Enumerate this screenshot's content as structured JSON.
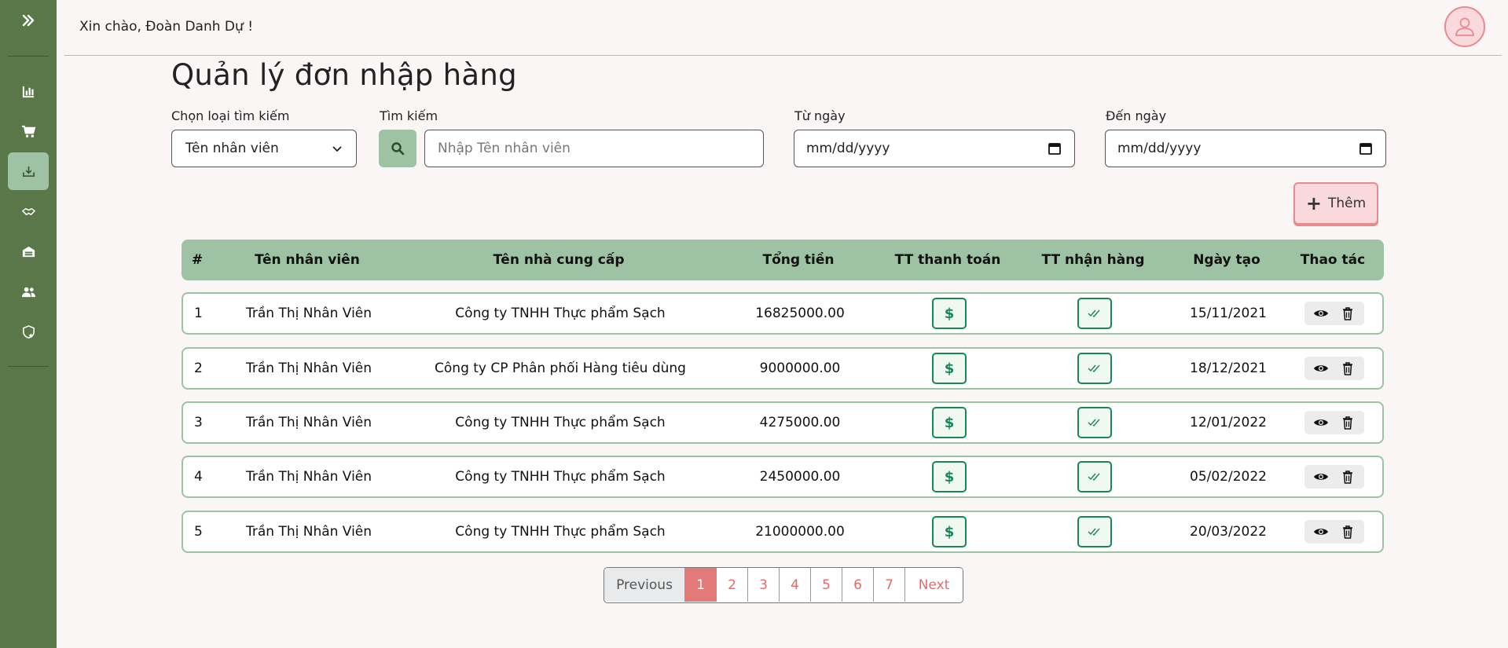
{
  "header": {
    "greeting": "Xin chào, Đoàn Danh Dự !"
  },
  "sidebar": {
    "items": [
      {
        "icon": "bar-chart-icon"
      },
      {
        "icon": "cart-icon"
      },
      {
        "icon": "import-icon",
        "active": true
      },
      {
        "icon": "handshake-icon"
      },
      {
        "icon": "warehouse-icon"
      },
      {
        "icon": "users-icon"
      },
      {
        "icon": "shield-star-icon"
      }
    ]
  },
  "page": {
    "title": "Quản lý đơn nhập hàng"
  },
  "filters": {
    "search_type_label": "Chọn loại tìm kiếm",
    "search_type_value": "Tên nhân viên",
    "search_label": "Tìm kiếm",
    "search_placeholder": "Nhập Tên nhân viên",
    "from_date_label": "Từ ngày",
    "from_date_value": "mm/dd/yyyy",
    "to_date_label": "Đến ngày",
    "to_date_value": "mm/dd/yyyy"
  },
  "add_button": "Thêm",
  "table": {
    "headers": [
      "#",
      "Tên nhân viên",
      "Tên nhà cung cấp",
      "Tổng tiền",
      "TT thanh toán",
      "TT nhận hàng",
      "Ngày tạo",
      "Thao tác"
    ],
    "rows": [
      {
        "id": "1",
        "employee": "Trần Thị Nhân Viên",
        "supplier": "Công ty TNHH Thực phẩm Sạch",
        "total": "16825000.00",
        "date": "15/11/2021"
      },
      {
        "id": "2",
        "employee": "Trần Thị Nhân Viên",
        "supplier": "Công ty CP Phân phối Hàng tiêu dùng",
        "total": "9000000.00",
        "date": "18/12/2021"
      },
      {
        "id": "3",
        "employee": "Trần Thị Nhân Viên",
        "supplier": "Công ty TNHH Thực phẩm Sạch",
        "total": "4275000.00",
        "date": "12/01/2022"
      },
      {
        "id": "4",
        "employee": "Trần Thị Nhân Viên",
        "supplier": "Công ty TNHH Thực phẩm Sạch",
        "total": "2450000.00",
        "date": "05/02/2022"
      },
      {
        "id": "5",
        "employee": "Trần Thị Nhân Viên",
        "supplier": "Công ty TNHH Thực phẩm Sạch",
        "total": "21000000.00",
        "date": "20/03/2022"
      }
    ]
  },
  "pagination": {
    "previous": "Previous",
    "pages": [
      "1",
      "2",
      "3",
      "4",
      "5",
      "6",
      "7"
    ],
    "active": "1",
    "next": "Next"
  },
  "colors": {
    "sidebar": "#5a774a",
    "accent_green": "#9dc3a4",
    "accent_pink": "#e88a90",
    "status_green": "#198754"
  }
}
